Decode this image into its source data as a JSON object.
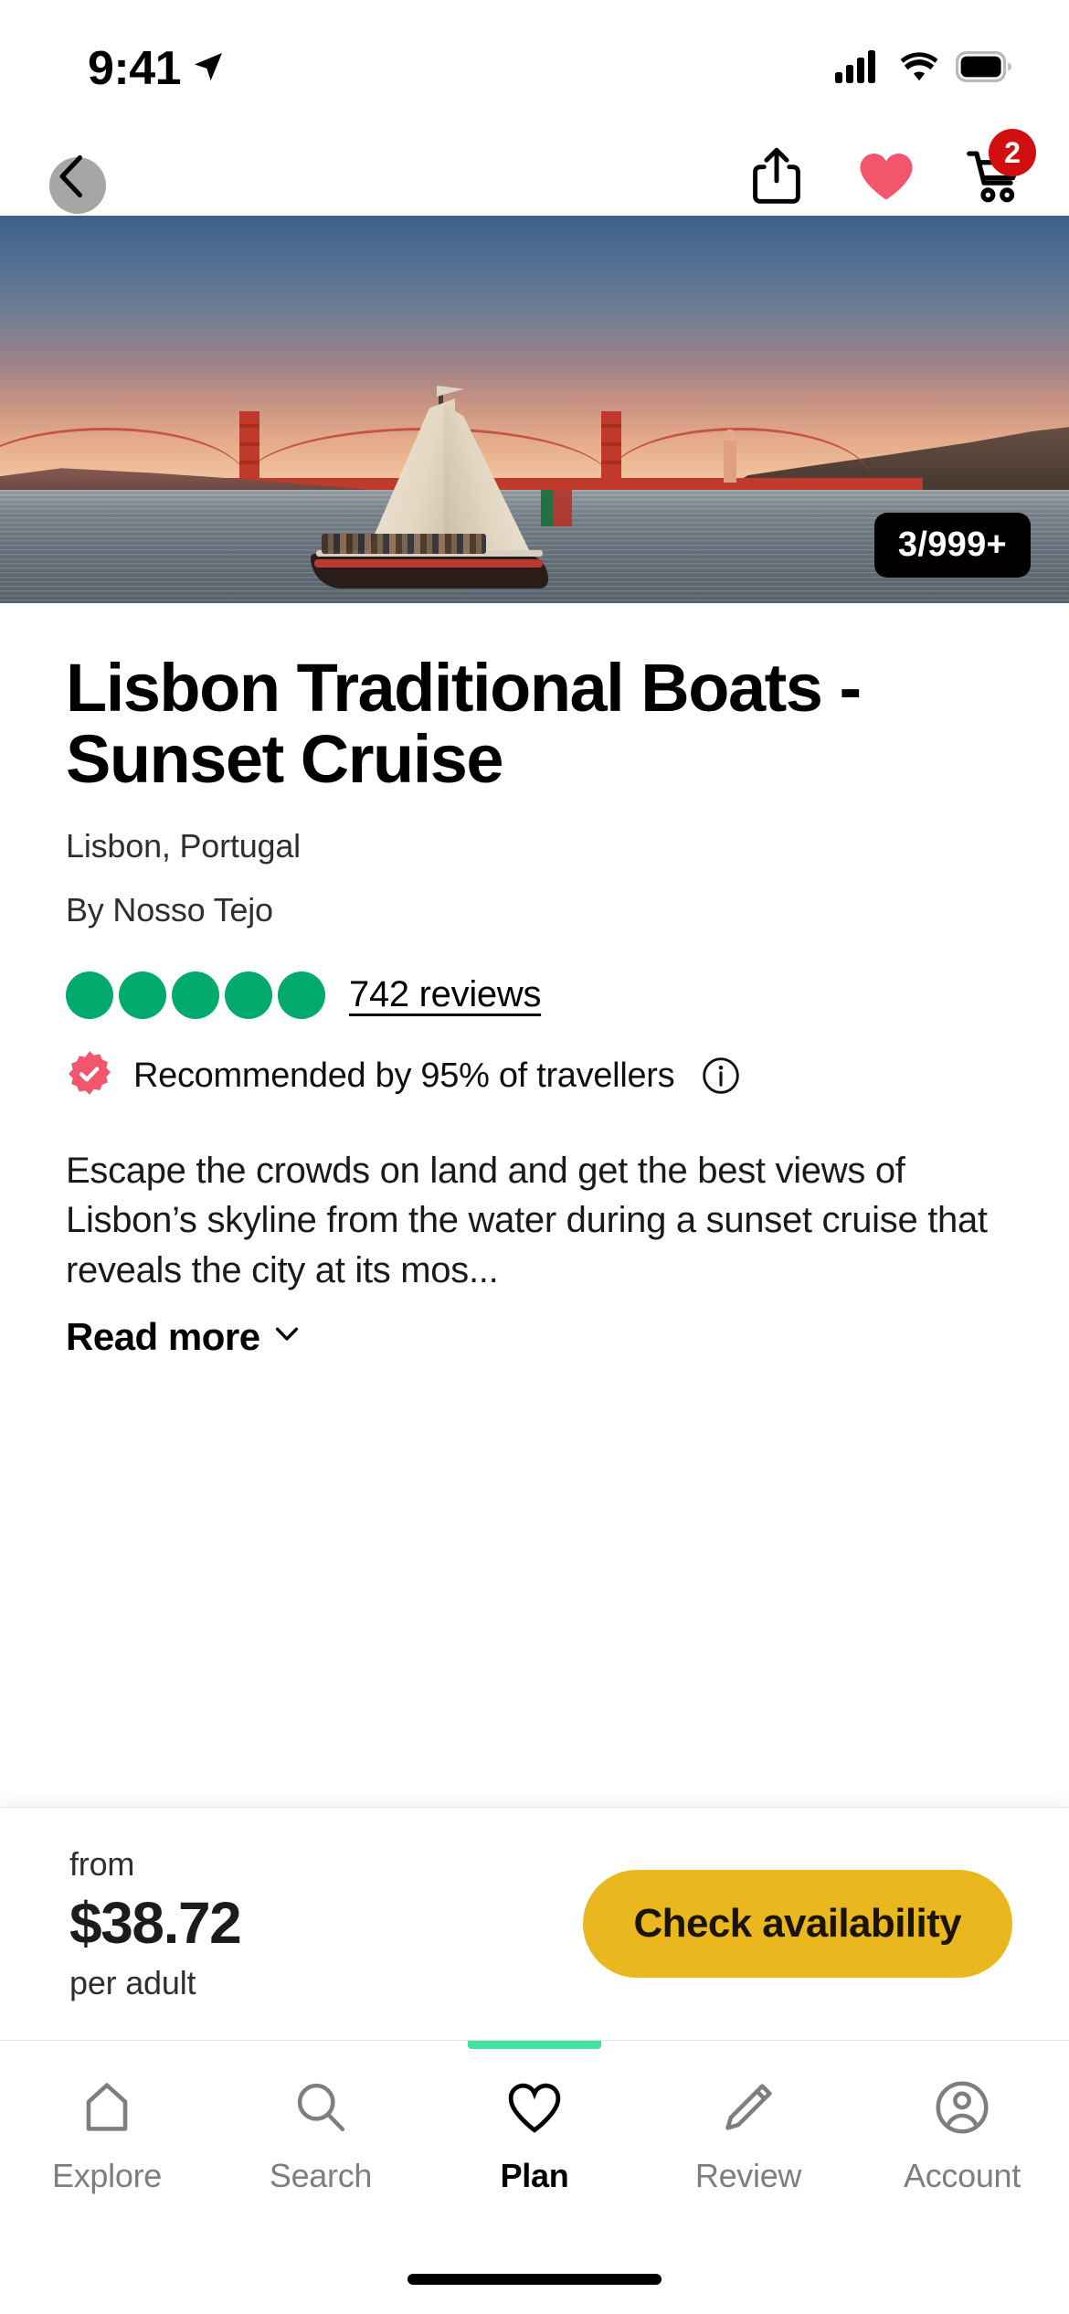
{
  "status_bar": {
    "time": "9:41",
    "location_icon": "location-arrow-icon",
    "signal_icon": "cellular-signal-icon",
    "wifi_icon": "wifi-icon",
    "battery_icon": "battery-full-icon"
  },
  "nav_bar": {
    "back_label": "back-chevron-icon",
    "share_label": "share-icon",
    "favourite_label": "heart-icon",
    "cart_label": "shopping-cart-icon",
    "cart_badge": "2"
  },
  "hero": {
    "counter": "3/999+",
    "alt": "Sailboat on the Tagus river at sunset with the 25 de Abril Bridge"
  },
  "product": {
    "title": "Lisbon Traditional Boats - Sunset Cruise",
    "location": "Lisbon, Portugal",
    "provider": "By Nosso Tejo",
    "rating_bubbles": 5,
    "reviews": "742 reviews",
    "recommended": "Recommended by 95% of travellers",
    "info_icon": "info-icon",
    "description": "Escape the crowds on land and get the best views of Lisbon’s skyline from the water during a sunset cruise that reveals the city at its mos...",
    "read_more": "Read more"
  },
  "price_bar": {
    "from_label": "from",
    "amount": "$38.72",
    "unit": "per adult",
    "cta": "Check availability"
  },
  "tab_bar": {
    "tabs": [
      {
        "label": "Explore",
        "icon": "home-icon",
        "active": false
      },
      {
        "label": "Search",
        "icon": "search-icon",
        "active": false
      },
      {
        "label": "Plan",
        "icon": "heart-outline-icon",
        "active": true
      },
      {
        "label": "Review",
        "icon": "pencil-icon",
        "active": false
      },
      {
        "label": "Account",
        "icon": "account-circle-icon",
        "active": false
      }
    ]
  },
  "colors": {
    "accent_yellow": "#eab81e",
    "rating_green": "#00aa6c",
    "recommend_pink": "#f2556c",
    "badge_red": "#d10f10",
    "tab_active_green": "#42e2a0"
  }
}
